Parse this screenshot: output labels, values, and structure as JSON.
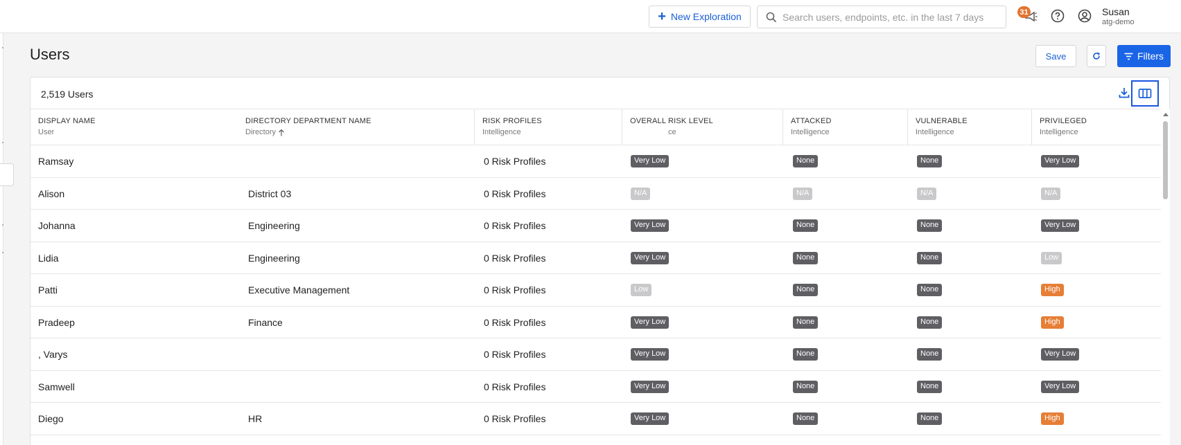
{
  "topbar": {
    "new_exploration_label": "New Exploration",
    "search_placeholder": "Search users, endpoints, etc. in the last 7 days",
    "notification_count": "31",
    "user_name": "Susan",
    "user_org": "atg-demo"
  },
  "page": {
    "title": "Users",
    "save_label": "Save",
    "filters_label": "Filters",
    "count_label": "2,519 Users"
  },
  "columns": [
    {
      "title": "DISPLAY NAME",
      "subtitle": "User"
    },
    {
      "title": "DIRECTORY DEPARTMENT NAME",
      "subtitle": "Directory"
    },
    {
      "title": "RISK PROFILES",
      "subtitle": "Intelligence"
    },
    {
      "title": "OVERALL RISK LEVEL",
      "subtitle": "ce"
    },
    {
      "title": "ATTACKED",
      "subtitle": "Intelligence"
    },
    {
      "title": "VULNERABLE",
      "subtitle": "Intelligence"
    },
    {
      "title": "PRIVILEGED",
      "subtitle": "Intelligence"
    }
  ],
  "rows": [
    {
      "name": "Ramsay",
      "dept": "",
      "profiles": "0 Risk Profiles",
      "overall": "Very Low",
      "attacked": "None",
      "vulnerable": "None",
      "privileged": "Very Low"
    },
    {
      "name": "Alison",
      "dept": "District 03",
      "profiles": "0 Risk Profiles",
      "overall": "N/A",
      "attacked": "N/A",
      "vulnerable": "N/A",
      "privileged": "N/A"
    },
    {
      "name": "Johanna",
      "dept": "Engineering",
      "profiles": "0 Risk Profiles",
      "overall": "Very Low",
      "attacked": "None",
      "vulnerable": "None",
      "privileged": "Very Low"
    },
    {
      "name": "Lidia",
      "dept": "Engineering",
      "profiles": "0 Risk Profiles",
      "overall": "Very Low",
      "attacked": "None",
      "vulnerable": "None",
      "privileged": "Low"
    },
    {
      "name": "Patti",
      "dept": "Executive Management",
      "profiles": "0 Risk Profiles",
      "overall": "Low",
      "attacked": "None",
      "vulnerable": "None",
      "privileged": "High"
    },
    {
      "name": "Pradeep",
      "dept": "Finance",
      "profiles": "0 Risk Profiles",
      "overall": "Very Low",
      "attacked": "None",
      "vulnerable": "None",
      "privileged": "High"
    },
    {
      "name": ", Varys",
      "dept": "",
      "profiles": "0 Risk Profiles",
      "overall": "Very Low",
      "attacked": "None",
      "vulnerable": "None",
      "privileged": "Very Low"
    },
    {
      "name": "Samwell",
      "dept": "",
      "profiles": "0 Risk Profiles",
      "overall": "Very Low",
      "attacked": "None",
      "vulnerable": "None",
      "privileged": "Very Low"
    },
    {
      "name": "Diego",
      "dept": "HR",
      "profiles": "0 Risk Profiles",
      "overall": "Very Low",
      "attacked": "None",
      "vulnerable": "None",
      "privileged": "High"
    }
  ],
  "colors": {
    "accent": "#1a64e6",
    "pill_dark": "#5f5f63",
    "pill_light": "#c9c9cb",
    "pill_high": "#e67e36",
    "highlight_box": "#1a55e0"
  },
  "icons": [
    "plus-icon",
    "search-icon",
    "megaphone-icon",
    "help-icon",
    "user-circle-icon",
    "refresh-icon",
    "filter-icon",
    "download-icon",
    "columns-icon",
    "sort-asc-icon"
  ]
}
